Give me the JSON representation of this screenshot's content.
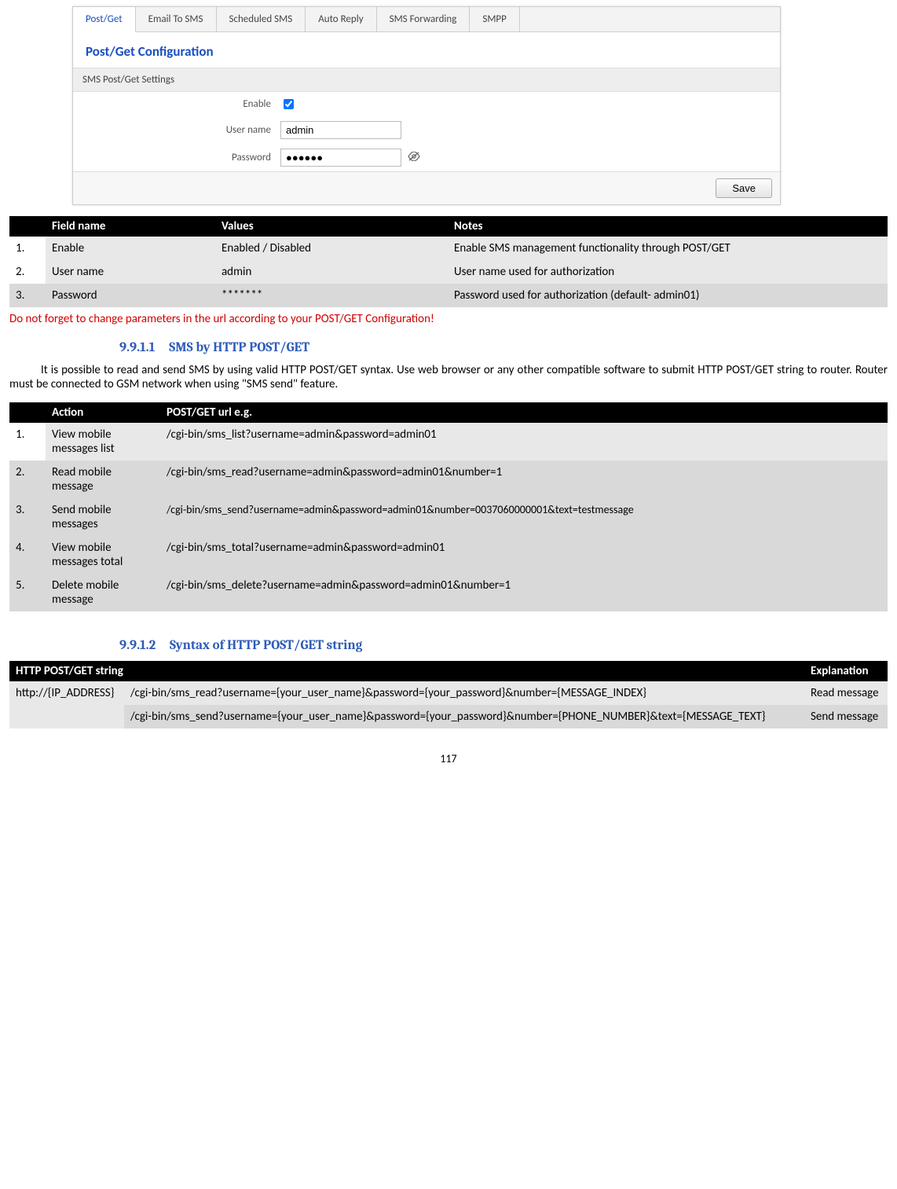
{
  "ui": {
    "tabs": [
      "Post/Get",
      "Email To SMS",
      "Scheduled SMS",
      "Auto Reply",
      "SMS Forwarding",
      "SMPP"
    ],
    "title": "Post/Get Configuration",
    "settings_header": "SMS Post/Get Settings",
    "rows": {
      "enable_label": "Enable",
      "username_label": "User name",
      "username_value": "admin",
      "password_label": "Password",
      "password_value": "●●●●●●"
    },
    "save": "Save"
  },
  "table1": {
    "headers": [
      "",
      "Field name",
      "Values",
      "Notes"
    ],
    "rows": [
      {
        "n": "1.",
        "field": "Enable",
        "val": "Enabled / Disabled",
        "notes": "Enable SMS management functionality through POST/GET"
      },
      {
        "n": "2.",
        "field": "User name",
        "val": "admin",
        "notes": "User name used for authorization"
      },
      {
        "n": "3.",
        "field": "Password",
        "val": "*******",
        "notes": "Password used for authorization (default- admin01)"
      }
    ]
  },
  "warning": "Do not forget to change parameters in the url according to your POST/GET Configuration!",
  "heading1_num": "9.9.1.1",
  "heading1_text": "SMS by HTTP POST/GET",
  "para1": "It is possible to read and send SMS by using valid HTTP POST/GET syntax. Use web browser or any other compatible software to submit HTTP POST/GET string to router. Router must be connected to GSM network when using \"SMS send\" feature.",
  "table2": {
    "headers": [
      "",
      "Action",
      "POST/GET url e.g."
    ],
    "rows": [
      {
        "n": "1.",
        "action": "View mobile messages list",
        "url": "/cgi-bin/sms_list?username=admin&password=admin01"
      },
      {
        "n": "2.",
        "action": "Read mobile message",
        "url": "/cgi-bin/sms_read?username=admin&password=admin01&number=1"
      },
      {
        "n": "3.",
        "action": "Send mobile messages",
        "url": "/cgi-bin/sms_send?username=admin&password=admin01&number=0037060000001&text=testmessage"
      },
      {
        "n": "4.",
        "action": "View mobile messages total",
        "url": "/cgi-bin/sms_total?username=admin&password=admin01"
      },
      {
        "n": "5.",
        "action": "Delete mobile message",
        "url": "/cgi-bin/sms_delete?username=admin&password=admin01&number=1"
      }
    ]
  },
  "heading2_num": "9.9.1.2",
  "heading2_text": "Syntax of HTTP POST/GET string",
  "table3": {
    "headers": [
      "HTTP POST/GET string",
      "",
      "Explanation"
    ],
    "host": "http://{IP_ADDRESS}",
    "rows": [
      {
        "url": "/cgi-bin/sms_read?username={your_user_name}&password={your_password}&number={MESSAGE_INDEX}",
        "exp": "Read message"
      },
      {
        "url": "/cgi-bin/sms_send?username={your_user_name}&password={your_password}&number={PHONE_NUMBER}&text={MESSAGE_TEXT}",
        "exp": "Send message"
      }
    ]
  },
  "pagenum": "117"
}
